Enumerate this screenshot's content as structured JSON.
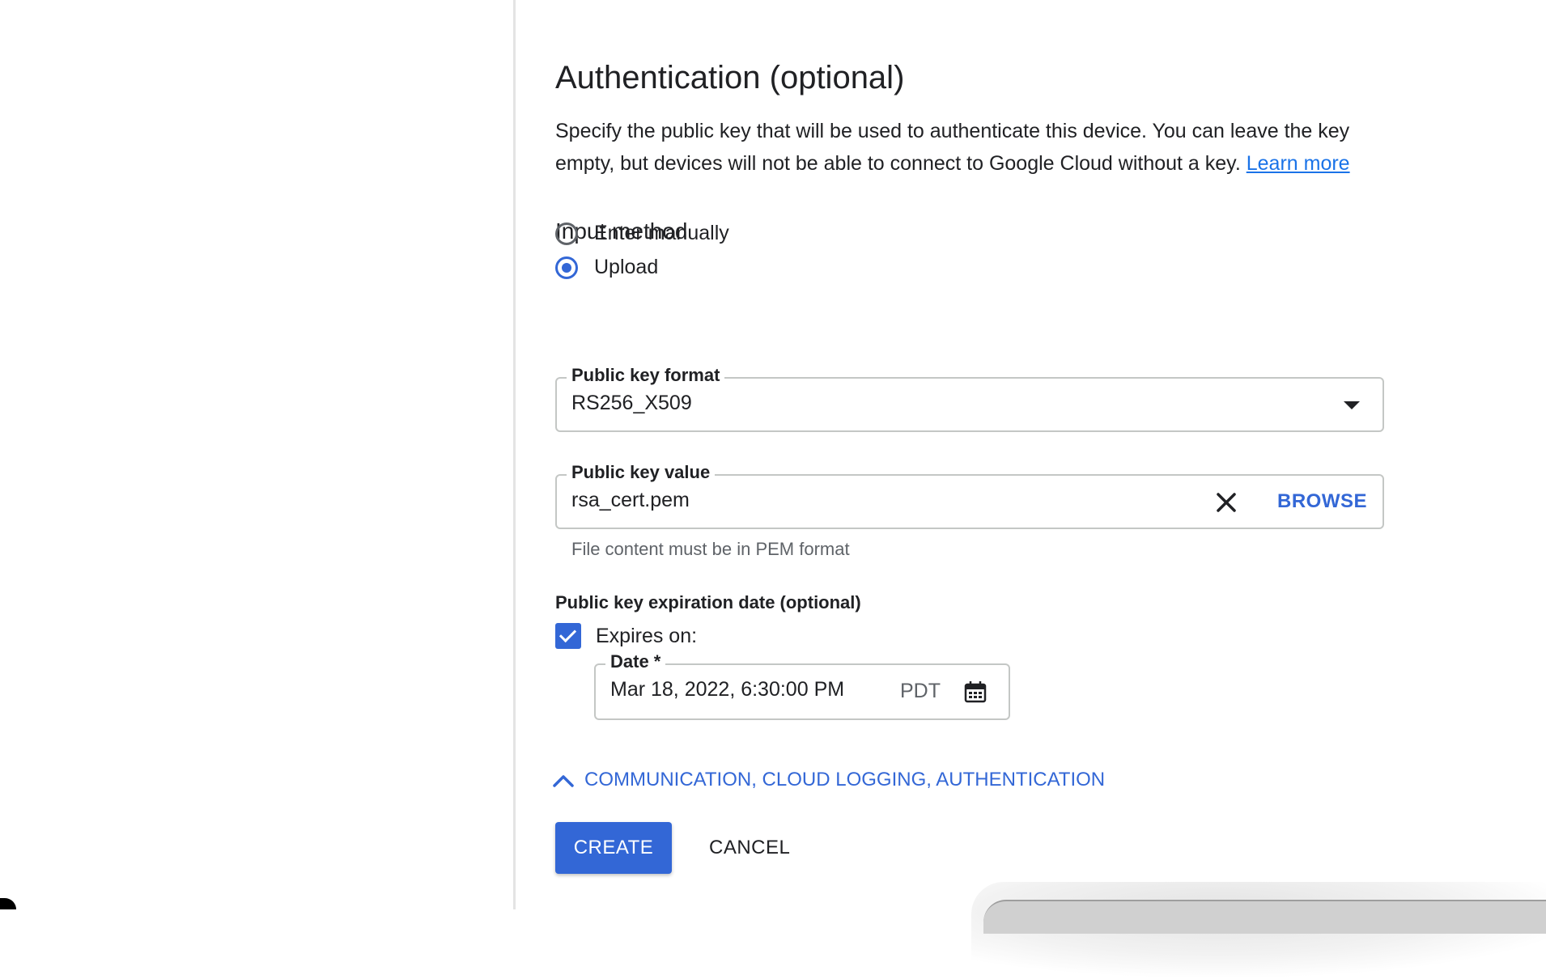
{
  "section": {
    "top_cut_text": "",
    "title": "Authentication (optional)",
    "description": "Specify the public key that will be used to authenticate this device. You can leave the key empty, but devices will not be able to connect to Google Cloud without a key.",
    "learn_more": "Learn more"
  },
  "input_method": {
    "title": "Input method",
    "options": [
      {
        "label": "Enter manually",
        "selected": false
      },
      {
        "label": "Upload",
        "selected": true
      }
    ]
  },
  "public_key_format": {
    "label": "Public key format",
    "value": "RS256_X509"
  },
  "public_key_value": {
    "label": "Public key value",
    "value": "rsa_cert.pem",
    "browse_label": "BROWSE",
    "hint": "File content must be in PEM format"
  },
  "expiration": {
    "title": "Public key expiration date (optional)",
    "checkbox_label": "Expires on:",
    "checked": true,
    "date_label": "Date *",
    "date_value": "Mar 18, 2022, 6:30:00 PM",
    "timezone": "PDT"
  },
  "expander": {
    "label": "COMMUNICATION, CLOUD LOGGING, AUTHENTICATION"
  },
  "actions": {
    "create_label": "CREATE",
    "cancel_label": "CANCEL"
  },
  "colors": {
    "accent": "#3367d6",
    "text": "#202124",
    "muted": "#5f6368",
    "border": "#c4c7c5"
  },
  "icons": [
    "close-icon",
    "calendar-icon",
    "chevron-up-icon",
    "dropdown-caret-icon",
    "check-icon"
  ]
}
